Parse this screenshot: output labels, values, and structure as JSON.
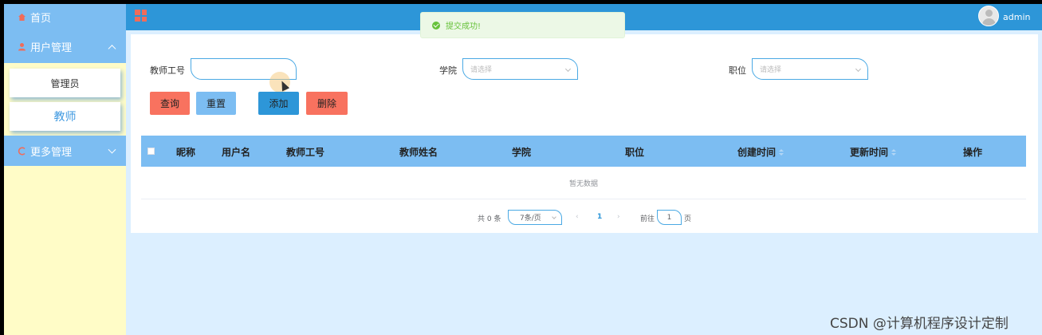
{
  "sidebar": {
    "home_label": "首页",
    "user_menu_label": "用户管理",
    "sub_items": [
      "管理员",
      "教师"
    ],
    "more_menu_label": "更多管理"
  },
  "header": {
    "user_name": "admin"
  },
  "toast": {
    "message": "提交成功!"
  },
  "form": {
    "teacher_id_label": "教师工号",
    "teacher_id_value": "",
    "college_label": "学院",
    "college_placeholder": "请选择",
    "position_label": "职位",
    "position_placeholder": "请选择"
  },
  "buttons": {
    "query": "查询",
    "reset": "重置",
    "add": "添加",
    "delete": "删除"
  },
  "table": {
    "columns": [
      "昵称",
      "用户名",
      "教师工号",
      "教师姓名",
      "学院",
      "职位",
      "创建时间",
      "更新时间",
      "操作"
    ],
    "empty_text": "暂无数据"
  },
  "pagination": {
    "total_text": "共 0 条",
    "page_size": "7条/页",
    "current_page": "1",
    "goto_label": "前往",
    "goto_value": "1",
    "page_suffix": "页"
  },
  "colors": {
    "header": "#2d96d8",
    "sidebar_menu": "#7cbdf2",
    "danger": "#f8725f",
    "sidebar_bg": "#fffcc7",
    "page_bg": "#dcefff"
  },
  "watermark": "CSDN @计算机程序设计定制"
}
